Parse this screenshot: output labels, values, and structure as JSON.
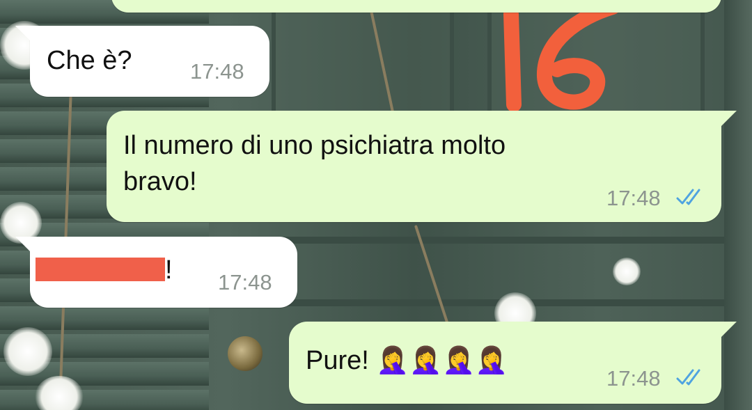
{
  "messages": [
    {
      "direction": "outgoing",
      "text": "",
      "partial": true
    },
    {
      "direction": "incoming",
      "text": "Che è?",
      "time": "17:48"
    },
    {
      "direction": "outgoing",
      "text": "Il numero di uno psichiatra molto\nbravo!",
      "time": "17:48",
      "status": "read-icon"
    },
    {
      "direction": "incoming",
      "text": "!",
      "time": "17:48",
      "redacted": true
    },
    {
      "direction": "outgoing",
      "text": "Pure! 🤦‍♀️🤦‍♀️🤦‍♀️🤦‍♀️",
      "time": "17:48",
      "status": "read-icon"
    }
  ],
  "overlay": {
    "handwritten_number": "16",
    "color": "#f2603c"
  },
  "colors": {
    "incoming_bubble": "#ffffff",
    "outgoing_bubble": "#e5fccd",
    "read_ticks": "#4fa3e0",
    "redaction": "#f0604a"
  }
}
